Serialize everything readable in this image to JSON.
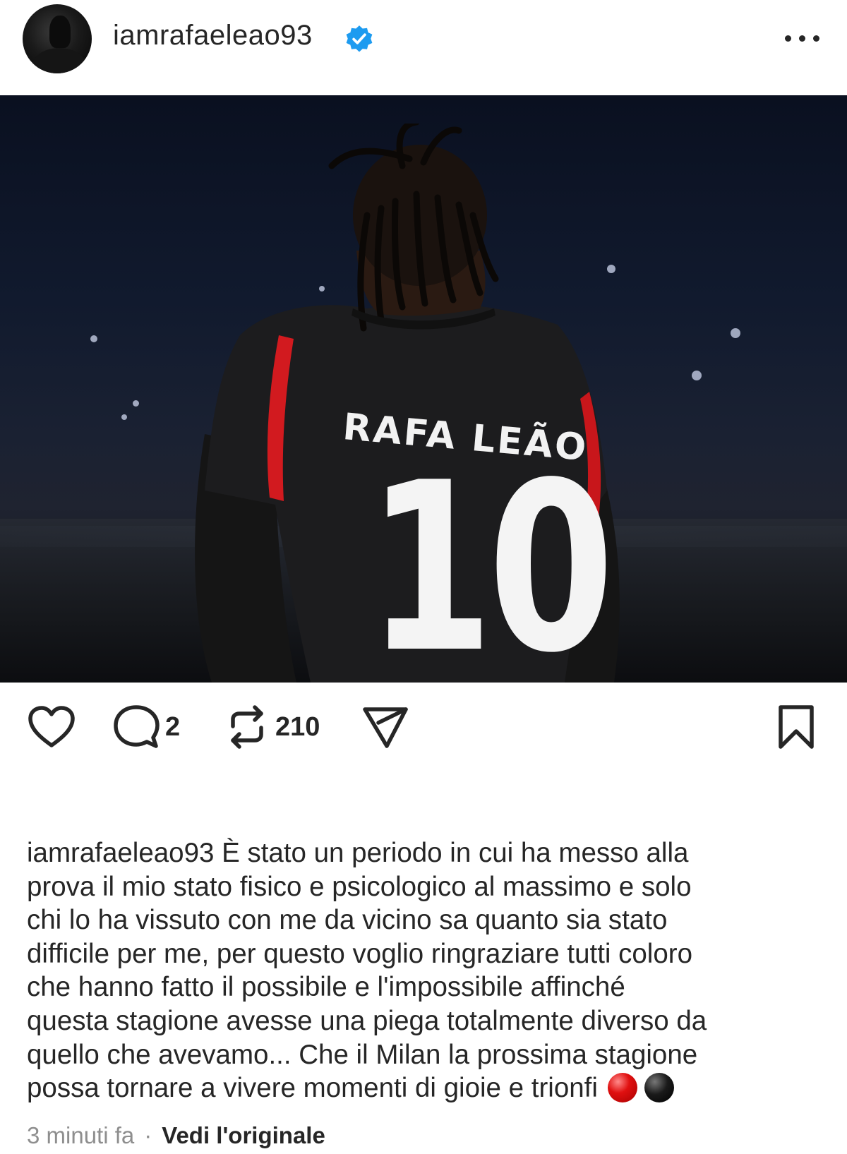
{
  "header": {
    "username": "iamrafaeleao93",
    "verified": true,
    "avatar_icon": "profile-avatar"
  },
  "post": {
    "image_alt_icons": "player-photo",
    "jersey_name": "RAFA LEÃO",
    "jersey_number": "10"
  },
  "actions": {
    "like_icon": "heart-icon",
    "comment_icon": "comment-icon",
    "comment_count": "2",
    "repost_icon": "repost-icon",
    "repost_count": "210",
    "share_icon": "send-icon",
    "save_icon": "bookmark-icon"
  },
  "caption": {
    "username": "iamrafaeleao93",
    "text": " È stato un periodo in cui ha messo alla\nprova il mio stato fisico e psicologico al massimo e solo\nchi lo ha vissuto con me da vicino sa quanto sia stato\ndifficile per me, per questo voglio ringraziare tutti coloro\nche hanno fatto il possibile e l'impossibile affinché\nquesta stagione avesse una piega totalmente diverso da\nquello che avevamo... Che il Milan la prossima stagione\npossa tornare a vivere momenti di gioie e trionfi",
    "emojis": [
      "red-circle",
      "black-circle"
    ]
  },
  "meta": {
    "timestamp": "3 minuti fa",
    "separator": "·",
    "translate_label": "Vedi l'originale"
  },
  "colors": {
    "verified_blue": "#1d9bf0",
    "text": "#262626",
    "muted": "#8e8e8e"
  }
}
